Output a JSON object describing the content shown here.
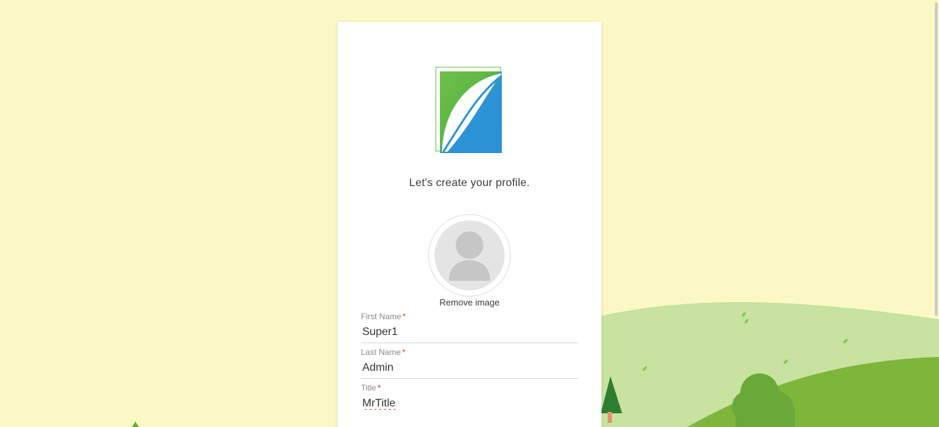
{
  "colors": {
    "page_background": "#fbf8c6",
    "hill_light": "#c5e09f",
    "hill_dark": "#7cb53a",
    "tree_dark": "#2e7d32",
    "logo_green": "#5cb845",
    "logo_blue": "#2b93d6",
    "required_asterisk": "#d93025"
  },
  "logo": {
    "icon": "leaf-book-logo-icon"
  },
  "profile": {
    "heading": "Let's create your profile.",
    "avatar_icon": "user-placeholder-icon",
    "remove_image_label": "Remove image"
  },
  "form": {
    "first_name": {
      "label": "First Name",
      "required_marker": "*",
      "value": "Super1"
    },
    "last_name": {
      "label": "Last Name",
      "required_marker": "*",
      "value": "Admin"
    },
    "title": {
      "label": "Title",
      "required_marker": "*",
      "value": "MrTitle"
    }
  }
}
